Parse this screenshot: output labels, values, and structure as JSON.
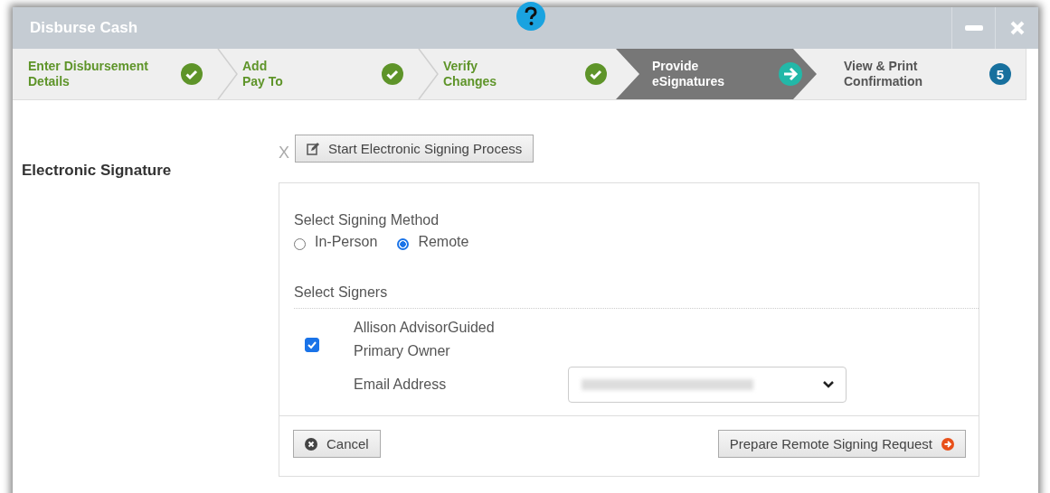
{
  "window": {
    "title": "Disburse Cash"
  },
  "steps": [
    {
      "label": "Enter Disbursement\nDetails",
      "kind": "done"
    },
    {
      "label": "Add\nPay To",
      "kind": "done"
    },
    {
      "label": "Verify\nChanges",
      "kind": "done"
    },
    {
      "label": "Provide\neSignatures",
      "kind": "current"
    },
    {
      "label": "View & Print\nConfirmation",
      "kind": "pending",
      "number": "5"
    }
  ],
  "section_label": "Electronic Signature",
  "dismiss": "X",
  "start_button": "Start Electronic Signing Process",
  "signing_method": {
    "label": "Select Signing Method",
    "options": [
      {
        "label": "In-Person",
        "selected": false
      },
      {
        "label": "Remote",
        "selected": true
      }
    ]
  },
  "signers": {
    "label": "Select Signers",
    "items": [
      {
        "checked": true,
        "name": "Allison AdvisorGuided",
        "role": "Primary Owner",
        "email_label": "Email Address"
      }
    ]
  },
  "buttons": {
    "cancel": "Cancel",
    "submit": "Prepare Remote Signing Request"
  }
}
